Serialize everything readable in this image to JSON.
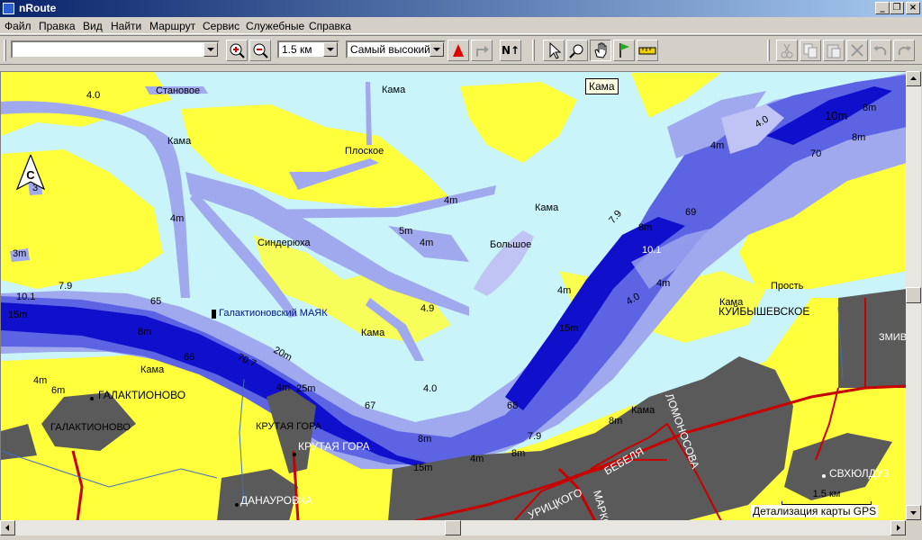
{
  "window": {
    "title": "nRoute"
  },
  "menu": [
    "Файл",
    "Правка",
    "Вид",
    "Найти",
    "Маршрут",
    "Сервис",
    "Служебные",
    "Справка"
  ],
  "toolbar": {
    "search_value": "",
    "scale_value": "1.5 км",
    "detail_value": "Самый высокий",
    "north_label": "N↑"
  },
  "map": {
    "tooltip": "Кама",
    "compass": "С",
    "scale_label": "1.5 км",
    "detail_label": "Детализация карты GPS",
    "colors": {
      "land": "#ffff3c",
      "shallow": "#c8f4fa",
      "mid": "#a0a8ee",
      "deep": "#5c64e4",
      "deepest": "#1010cc",
      "urban": "#5a5a5a",
      "road": "#c80000"
    },
    "labels": [
      {
        "id": "l1",
        "text": "4.0"
      },
      {
        "id": "l2",
        "text": "Становое"
      },
      {
        "id": "l3",
        "text": "Кама"
      },
      {
        "id": "l4",
        "text": "Кама"
      },
      {
        "id": "l5",
        "text": "Плоское"
      },
      {
        "id": "l6",
        "text": "4m"
      },
      {
        "id": "l7",
        "text": "3"
      },
      {
        "id": "l8",
        "text": "4m"
      },
      {
        "id": "l9",
        "text": "Синдерюха"
      },
      {
        "id": "l10",
        "text": "5m"
      },
      {
        "id": "l11",
        "text": "4m"
      },
      {
        "id": "l12",
        "text": "Кама"
      },
      {
        "id": "l13",
        "text": "Большое"
      },
      {
        "id": "l14",
        "text": "3m"
      },
      {
        "id": "l15",
        "text": "10.1"
      },
      {
        "id": "l16",
        "text": "7.9"
      },
      {
        "id": "l17",
        "text": "15m"
      },
      {
        "id": "l18",
        "text": "65"
      },
      {
        "id": "l19",
        "text": "Галактионовский МАЯК"
      },
      {
        "id": "l20",
        "text": "4.9"
      },
      {
        "id": "l21",
        "text": "8m"
      },
      {
        "id": "l22",
        "text": "Кама"
      },
      {
        "id": "l23",
        "text": "66"
      },
      {
        "id": "l24",
        "text": "70.7"
      },
      {
        "id": "l25",
        "text": "20m"
      },
      {
        "id": "l26",
        "text": "Кама"
      },
      {
        "id": "l27",
        "text": "4m"
      },
      {
        "id": "l28",
        "text": "6m"
      },
      {
        "id": "l29",
        "text": "ГАЛАКТИОНОВО"
      },
      {
        "id": "l30",
        "text": "ГАЛАКТИОНОВО"
      },
      {
        "id": "l31",
        "text": "4m"
      },
      {
        "id": "l32",
        "text": "25m"
      },
      {
        "id": "l33",
        "text": "КРУТАЯ ГОРА"
      },
      {
        "id": "l34",
        "text": "КРУТАЯ ГОРА"
      },
      {
        "id": "l35",
        "text": "67"
      },
      {
        "id": "l36",
        "text": "4.0"
      },
      {
        "id": "l37",
        "text": "8m"
      },
      {
        "id": "l38",
        "text": "15m"
      },
      {
        "id": "l39",
        "text": "4m"
      },
      {
        "id": "l40",
        "text": "ДАНАУРОВКА"
      },
      {
        "id": "l41",
        "text": "10m"
      },
      {
        "id": "l42",
        "text": "8m"
      },
      {
        "id": "l43",
        "text": "4.0"
      },
      {
        "id": "l44",
        "text": "8m"
      },
      {
        "id": "l45",
        "text": "4m"
      },
      {
        "id": "l46",
        "text": "70"
      },
      {
        "id": "l47",
        "text": "7.9"
      },
      {
        "id": "l48",
        "text": "8m"
      },
      {
        "id": "l49",
        "text": "69"
      },
      {
        "id": "l50",
        "text": "10.1"
      },
      {
        "id": "l51",
        "text": "4m"
      },
      {
        "id": "l52",
        "text": "4m"
      },
      {
        "id": "l53",
        "text": "4.0"
      },
      {
        "id": "l54",
        "text": "Кама"
      },
      {
        "id": "l55",
        "text": "Прость"
      },
      {
        "id": "l56",
        "text": "КУЙБЫШЕВСКОЕ"
      },
      {
        "id": "l57",
        "text": "15m"
      },
      {
        "id": "l58",
        "text": "68"
      },
      {
        "id": "l59",
        "text": "8m"
      },
      {
        "id": "l60",
        "text": "Кама"
      },
      {
        "id": "l61",
        "text": "ЛОМОНОСОВА"
      },
      {
        "id": "l62",
        "text": "7.9"
      },
      {
        "id": "l63",
        "text": "8m"
      },
      {
        "id": "l64",
        "text": "БЕБЕЛЯ"
      },
      {
        "id": "l65",
        "text": "МАРКСА"
      },
      {
        "id": "l66",
        "text": "УРИЦКОГО"
      },
      {
        "id": "l67",
        "text": "СВХЮЛДУЗ"
      },
      {
        "id": "l68",
        "text": "ЗМИВ"
      }
    ]
  }
}
